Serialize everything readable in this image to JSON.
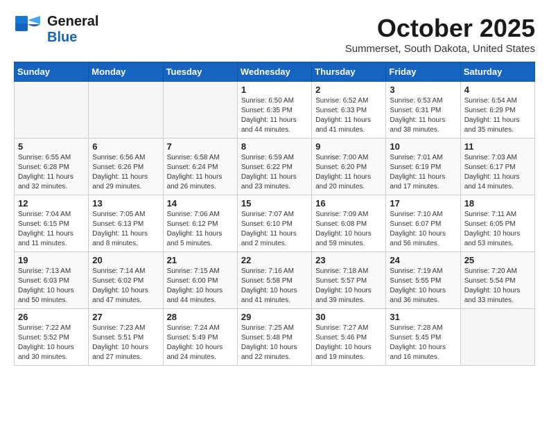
{
  "header": {
    "logo_general": "General",
    "logo_blue": "Blue",
    "month": "October 2025",
    "location": "Summerset, South Dakota, United States"
  },
  "weekdays": [
    "Sunday",
    "Monday",
    "Tuesday",
    "Wednesday",
    "Thursday",
    "Friday",
    "Saturday"
  ],
  "weeks": [
    [
      {
        "day": "",
        "info": ""
      },
      {
        "day": "",
        "info": ""
      },
      {
        "day": "",
        "info": ""
      },
      {
        "day": "1",
        "info": "Sunrise: 6:50 AM\nSunset: 6:35 PM\nDaylight: 11 hours\nand 44 minutes."
      },
      {
        "day": "2",
        "info": "Sunrise: 6:52 AM\nSunset: 6:33 PM\nDaylight: 11 hours\nand 41 minutes."
      },
      {
        "day": "3",
        "info": "Sunrise: 6:53 AM\nSunset: 6:31 PM\nDaylight: 11 hours\nand 38 minutes."
      },
      {
        "day": "4",
        "info": "Sunrise: 6:54 AM\nSunset: 6:29 PM\nDaylight: 11 hours\nand 35 minutes."
      }
    ],
    [
      {
        "day": "5",
        "info": "Sunrise: 6:55 AM\nSunset: 6:28 PM\nDaylight: 11 hours\nand 32 minutes."
      },
      {
        "day": "6",
        "info": "Sunrise: 6:56 AM\nSunset: 6:26 PM\nDaylight: 11 hours\nand 29 minutes."
      },
      {
        "day": "7",
        "info": "Sunrise: 6:58 AM\nSunset: 6:24 PM\nDaylight: 11 hours\nand 26 minutes."
      },
      {
        "day": "8",
        "info": "Sunrise: 6:59 AM\nSunset: 6:22 PM\nDaylight: 11 hours\nand 23 minutes."
      },
      {
        "day": "9",
        "info": "Sunrise: 7:00 AM\nSunset: 6:20 PM\nDaylight: 11 hours\nand 20 minutes."
      },
      {
        "day": "10",
        "info": "Sunrise: 7:01 AM\nSunset: 6:19 PM\nDaylight: 11 hours\nand 17 minutes."
      },
      {
        "day": "11",
        "info": "Sunrise: 7:03 AM\nSunset: 6:17 PM\nDaylight: 11 hours\nand 14 minutes."
      }
    ],
    [
      {
        "day": "12",
        "info": "Sunrise: 7:04 AM\nSunset: 6:15 PM\nDaylight: 11 hours\nand 11 minutes."
      },
      {
        "day": "13",
        "info": "Sunrise: 7:05 AM\nSunset: 6:13 PM\nDaylight: 11 hours\nand 8 minutes."
      },
      {
        "day": "14",
        "info": "Sunrise: 7:06 AM\nSunset: 6:12 PM\nDaylight: 11 hours\nand 5 minutes."
      },
      {
        "day": "15",
        "info": "Sunrise: 7:07 AM\nSunset: 6:10 PM\nDaylight: 11 hours\nand 2 minutes."
      },
      {
        "day": "16",
        "info": "Sunrise: 7:09 AM\nSunset: 6:08 PM\nDaylight: 10 hours\nand 59 minutes."
      },
      {
        "day": "17",
        "info": "Sunrise: 7:10 AM\nSunset: 6:07 PM\nDaylight: 10 hours\nand 56 minutes."
      },
      {
        "day": "18",
        "info": "Sunrise: 7:11 AM\nSunset: 6:05 PM\nDaylight: 10 hours\nand 53 minutes."
      }
    ],
    [
      {
        "day": "19",
        "info": "Sunrise: 7:13 AM\nSunset: 6:03 PM\nDaylight: 10 hours\nand 50 minutes."
      },
      {
        "day": "20",
        "info": "Sunrise: 7:14 AM\nSunset: 6:02 PM\nDaylight: 10 hours\nand 47 minutes."
      },
      {
        "day": "21",
        "info": "Sunrise: 7:15 AM\nSunset: 6:00 PM\nDaylight: 10 hours\nand 44 minutes."
      },
      {
        "day": "22",
        "info": "Sunrise: 7:16 AM\nSunset: 5:58 PM\nDaylight: 10 hours\nand 41 minutes."
      },
      {
        "day": "23",
        "info": "Sunrise: 7:18 AM\nSunset: 5:57 PM\nDaylight: 10 hours\nand 39 minutes."
      },
      {
        "day": "24",
        "info": "Sunrise: 7:19 AM\nSunset: 5:55 PM\nDaylight: 10 hours\nand 36 minutes."
      },
      {
        "day": "25",
        "info": "Sunrise: 7:20 AM\nSunset: 5:54 PM\nDaylight: 10 hours\nand 33 minutes."
      }
    ],
    [
      {
        "day": "26",
        "info": "Sunrise: 7:22 AM\nSunset: 5:52 PM\nDaylight: 10 hours\nand 30 minutes."
      },
      {
        "day": "27",
        "info": "Sunrise: 7:23 AM\nSunset: 5:51 PM\nDaylight: 10 hours\nand 27 minutes."
      },
      {
        "day": "28",
        "info": "Sunrise: 7:24 AM\nSunset: 5:49 PM\nDaylight: 10 hours\nand 24 minutes."
      },
      {
        "day": "29",
        "info": "Sunrise: 7:25 AM\nSunset: 5:48 PM\nDaylight: 10 hours\nand 22 minutes."
      },
      {
        "day": "30",
        "info": "Sunrise: 7:27 AM\nSunset: 5:46 PM\nDaylight: 10 hours\nand 19 minutes."
      },
      {
        "day": "31",
        "info": "Sunrise: 7:28 AM\nSunset: 5:45 PM\nDaylight: 10 hours\nand 16 minutes."
      },
      {
        "day": "",
        "info": ""
      }
    ]
  ]
}
